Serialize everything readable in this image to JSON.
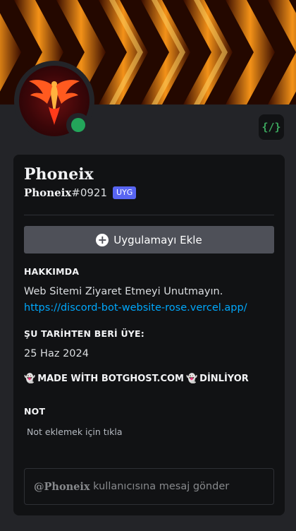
{
  "profile": {
    "display_name": "Phoneix",
    "username": "Phoneix",
    "discriminator": "#0921",
    "app_badge": "UYG",
    "status": "online",
    "dev_badge": "{/}"
  },
  "actions": {
    "add_app_label": "Uygulamayı Ekle"
  },
  "about": {
    "title": "HAKKIMDA",
    "line1": "Web Sitemi Ziyaret Etmeyi Unutmayın.",
    "link": "https://discord-bot-website-rose.vercel.app/"
  },
  "member_since": {
    "title": "ŞU TARİHTEN BERİ ÜYE:",
    "date": "25 Haz 2024"
  },
  "activity": {
    "prefix": "MADE WİTH BOTGHOST.COM",
    "suffix": "DİNLİYOR"
  },
  "note": {
    "title": "NOT",
    "placeholder": "Not eklemek için tıkla"
  },
  "message": {
    "at_name": "@Phoneix",
    "rest": " kullanıcısına mesaj gönder"
  },
  "colors": {
    "status_online": "#23a55a",
    "accent": "#5865f2",
    "link": "#00a8fc"
  }
}
